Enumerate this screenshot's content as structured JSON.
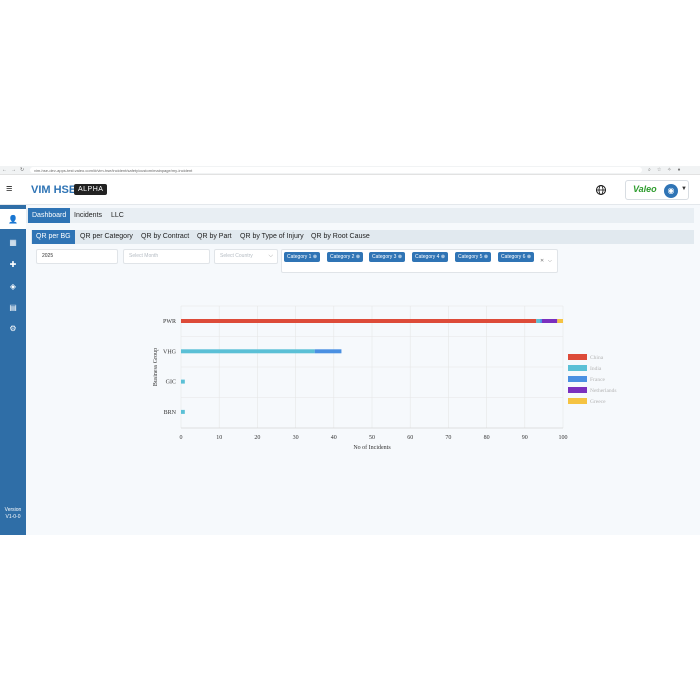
{
  "browser": {
    "url": "vim-hse-dev-apps-test.valeo.com/#/vim-hse/incident/safety/custom/mainpage/my-incident",
    "nav": [
      "←",
      "→",
      "↻"
    ],
    "extensions": [
      "zoom-icon",
      "star-icon",
      "shield-icon",
      "puzzle-icon",
      "profile-icon"
    ]
  },
  "header": {
    "app_title": "VIM HSE",
    "env_badge": "ALPHA",
    "logo_text": "Valeo",
    "avatar_icon": "user-icon"
  },
  "sidebar": {
    "items": [
      {
        "icon": "user-settings-icon",
        "active": true
      },
      {
        "icon": "building-icon",
        "active": false
      },
      {
        "icon": "first-aid-icon",
        "active": false
      },
      {
        "icon": "layers-icon",
        "active": false
      },
      {
        "icon": "document-icon",
        "active": false
      },
      {
        "icon": "users-gear-icon",
        "active": false
      }
    ],
    "version_label": "Version",
    "version_value": "V1-0-0"
  },
  "main_tabs": [
    {
      "label": "Dashboard",
      "active": true
    },
    {
      "label": "Incidents",
      "active": false
    },
    {
      "label": "LLC",
      "active": false
    }
  ],
  "sub_tabs": [
    {
      "label": "QR per BG",
      "active": true
    },
    {
      "label": "QR per Category",
      "active": false
    },
    {
      "label": "QR by Contract",
      "active": false
    },
    {
      "label": "QR by Part",
      "active": false
    },
    {
      "label": "QR by Type of Injury",
      "active": false
    },
    {
      "label": "QR by Root Cause",
      "active": false
    }
  ],
  "filters": {
    "year": "2025",
    "month_placeholder": "Select Month",
    "country_placeholder": "Select Country",
    "categories": [
      "Category 1 ⊗",
      "Category 2 ⊗",
      "Category 3 ⊗",
      "Category 4 ⊗",
      "Category 5 ⊗",
      "Category 6 ⊗"
    ],
    "clear": "✕",
    "dropdown": "⌵"
  },
  "chart_data": {
    "type": "bar",
    "orientation": "horizontal",
    "stacked": true,
    "categories": [
      "PWR",
      "VHG",
      "GIC",
      "BRN"
    ],
    "xlabel": "No of Incidents",
    "ylabel": "Business Group",
    "xlim": [
      0,
      100
    ],
    "xticks": [
      0,
      10,
      20,
      30,
      40,
      50,
      60,
      70,
      80,
      90,
      100
    ],
    "grid": true,
    "legend_position": "right",
    "series": [
      {
        "name": "China",
        "color": "#dd4b39",
        "values": [
          93,
          0,
          0,
          0
        ]
      },
      {
        "name": "India",
        "color": "#5bc0d6",
        "values": [
          1,
          35,
          1,
          1
        ]
      },
      {
        "name": "France",
        "color": "#4a90e2",
        "values": [
          0.5,
          7,
          0,
          0
        ]
      },
      {
        "name": "Netherlands",
        "color": "#7b2fbe",
        "values": [
          4,
          0,
          0,
          0
        ]
      },
      {
        "name": "Greece",
        "color": "#f5c342",
        "values": [
          1.5,
          0,
          0,
          0
        ]
      }
    ]
  }
}
